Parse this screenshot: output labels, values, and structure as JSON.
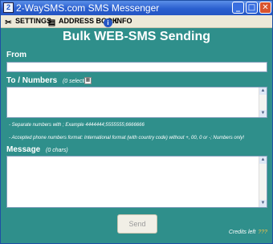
{
  "window": {
    "title": "2-WaySMS.com SMS Messenger",
    "icon_char": "2",
    "controls": {
      "minimize": "_",
      "maximize": "□",
      "close": "✕"
    }
  },
  "menu": {
    "items": [
      {
        "label": "SETTINGS",
        "icon": "tools-icon"
      },
      {
        "label": "ADDRESS BOOK",
        "icon": "address-book-icon"
      },
      {
        "label": "INFO",
        "icon": "info-icon"
      }
    ]
  },
  "form": {
    "heading": "Bulk WEB-SMS Sending",
    "from_label": "From",
    "from_value": "",
    "to_label": "To / Numbers",
    "to_count": "(0 selected)",
    "to_value": "",
    "note_separate": "- Separate numbers with ;  Example 4444444;5555555;6666666",
    "note_format": "- Accepted phone numbers format: International format (with country code) without +, 00, 0 or -; Numbers only!",
    "message_label": "Message",
    "message_count": "(0 chars)",
    "message_value": "",
    "send_label": "Send",
    "credits_label": "Credits left",
    "credits_value": "???"
  },
  "colors": {
    "background": "#2f8f8b",
    "titlebar": "#2a5fcf",
    "menubar": "#ece9d8"
  }
}
